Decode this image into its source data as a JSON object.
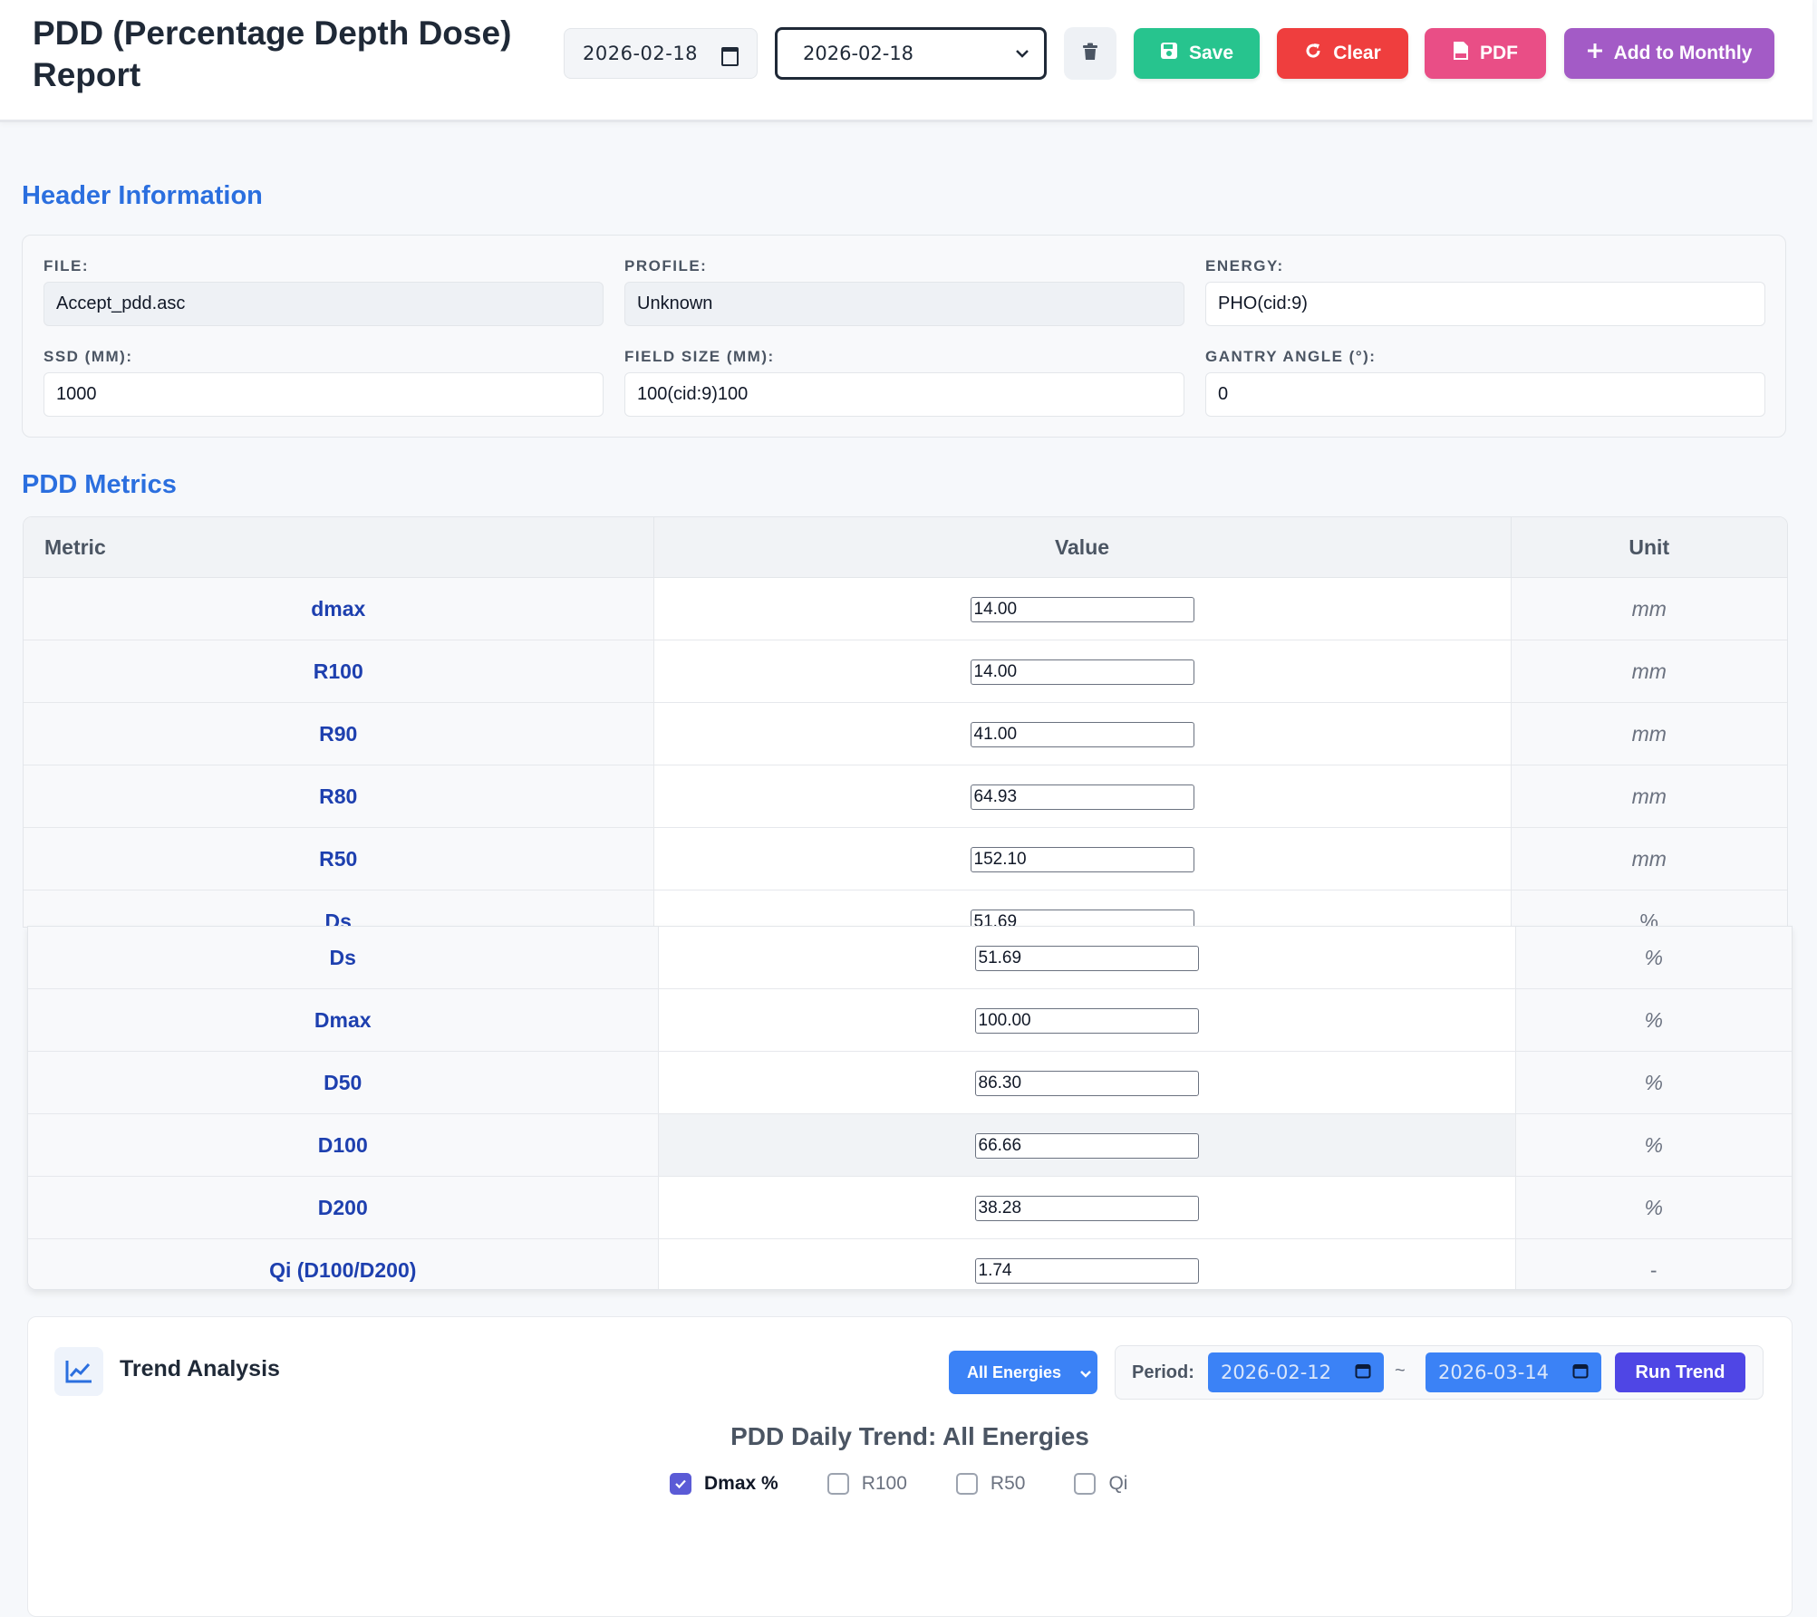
{
  "page": {
    "title": "PDD (Percentage Depth Dose) Report"
  },
  "toolbar": {
    "date_value": "2026-02-18",
    "saved_date_value": "2026-02-18",
    "save_label": "Save",
    "clear_label": "Clear",
    "pdf_label": "PDF",
    "monthly_label": "Add to Monthly"
  },
  "header_info": {
    "section_title": "Header Information",
    "fields": [
      {
        "label": "FILE:",
        "value": "Accept_pdd.asc"
      },
      {
        "label": "PROFILE:",
        "value": "Unknown"
      },
      {
        "label": "ENERGY:",
        "value": "PHO(cid:9)"
      },
      {
        "label": "SSD (MM):",
        "value": "1000"
      },
      {
        "label": "FIELD SIZE (MM):",
        "value": "100(cid:9)100"
      },
      {
        "label": "GANTRY ANGLE (°):",
        "value": "0"
      }
    ]
  },
  "metrics": {
    "section_title": "PDD Metrics",
    "columns": [
      "Metric",
      "Value",
      "Unit"
    ],
    "rows": [
      {
        "metric": "dmax",
        "value": "14.00",
        "unit": "mm"
      },
      {
        "metric": "R100",
        "value": "14.00",
        "unit": "mm"
      },
      {
        "metric": "R90",
        "value": "41.00",
        "unit": "mm"
      },
      {
        "metric": "R80",
        "value": "64.93",
        "unit": "mm"
      },
      {
        "metric": "R50",
        "value": "152.10",
        "unit": "mm"
      },
      {
        "metric": "Ds",
        "value": "51.69",
        "unit": "%"
      }
    ],
    "rows_continued": [
      {
        "metric": "Ds",
        "value": "51.69",
        "unit": "%"
      },
      {
        "metric": "Dmax",
        "value": "100.00",
        "unit": "%"
      },
      {
        "metric": "D50",
        "value": "86.30",
        "unit": "%"
      },
      {
        "metric": "D100",
        "value": "66.66",
        "unit": "%"
      },
      {
        "metric": "D200",
        "value": "38.28",
        "unit": "%"
      },
      {
        "metric": "Qi (D100/D200)",
        "value": "1.74",
        "unit": "-"
      }
    ]
  },
  "trend": {
    "title": "Trend Analysis",
    "energy_filter": "All Energies",
    "period_label": "Period:",
    "period_start": "2026-02-12",
    "period_separator": "~",
    "period_end": "2026-03-14",
    "run_label": "Run Trend",
    "chart_title": "PDD Daily Trend: All Energies",
    "series_toggles": [
      {
        "label": "Dmax %",
        "checked": true
      },
      {
        "label": "R100",
        "checked": false
      },
      {
        "label": "R50",
        "checked": false
      },
      {
        "label": "Qi",
        "checked": false
      }
    ]
  },
  "colors": {
    "accent_blue": "#2b6fdf",
    "save_green": "#27c48e",
    "clear_red": "#ef3e3e",
    "pdf_pink": "#e94e86",
    "monthly_purple": "#a35bc6",
    "run_indigo": "#4f46e5"
  },
  "icons": [
    "calendar-icon",
    "chevron-down-icon",
    "trash-icon",
    "save-icon",
    "refresh-icon",
    "pdf-file-icon",
    "plus-icon",
    "line-chart-icon",
    "check-icon"
  ]
}
